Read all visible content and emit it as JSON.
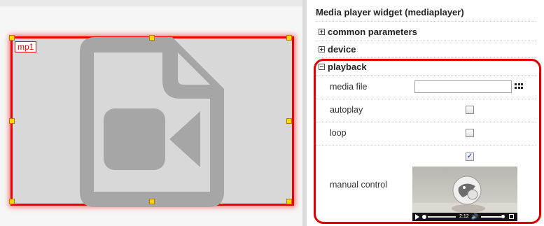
{
  "canvas": {
    "widget_id": "mp1",
    "placeholder_icon": "video-file-icon"
  },
  "panel": {
    "title": "Media player widget (mediaplayer)",
    "sections": {
      "common": "common parameters",
      "device": "device",
      "playback": "playback"
    },
    "properties": {
      "media_file": {
        "label": "media file",
        "value": "",
        "picker_icon": "grid-picker-icon"
      },
      "autoplay": {
        "label": "autoplay",
        "checked": false
      },
      "loop": {
        "label": "loop",
        "checked": false
      },
      "manual_control": {
        "label": "manual control",
        "checked": true,
        "checkmark": "✓",
        "preview_icon": "video-preview-thumbnail"
      }
    },
    "video_preview": {
      "time": "2:12"
    }
  },
  "colors": {
    "selection": "#ee0000",
    "handle": "#ffd800",
    "placeholder_fill": "#d8d8d8",
    "placeholder_icon": "#a6a6a6"
  }
}
